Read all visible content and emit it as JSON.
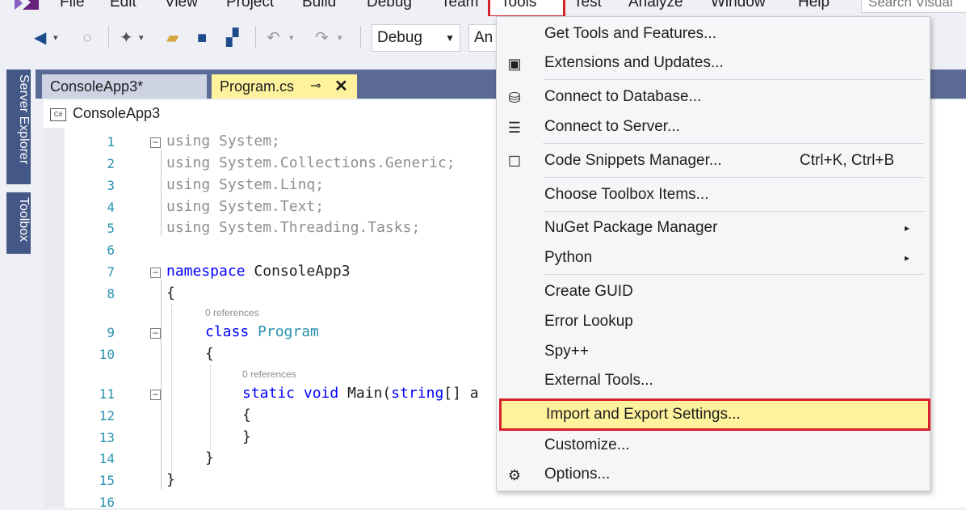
{
  "menubar": {
    "items": [
      "File",
      "Edit",
      "View",
      "Project",
      "Build",
      "Debug",
      "Team",
      "Tools",
      "Test",
      "Analyze",
      "Window",
      "Help"
    ],
    "search_placeholder": "Search Visual"
  },
  "toolbar": {
    "config_value": "Debug",
    "platform_value": "An"
  },
  "dock": {
    "server_explorer": "Server Explorer",
    "toolbox": "Toolbox"
  },
  "tabs": {
    "inactive": "ConsoleApp3*",
    "active": "Program.cs"
  },
  "navbar": {
    "project": "ConsoleApp3"
  },
  "editor": {
    "line_numbers": [
      "1",
      "2",
      "3",
      "4",
      "5",
      "6",
      "7",
      "8",
      "9",
      "10",
      "11",
      "12",
      "13",
      "14",
      "15",
      "16"
    ],
    "lines": {
      "l1": "System;",
      "l2": "System.Collections.Generic;",
      "l3": "System.Linq;",
      "l4": "System.Text;",
      "l5": "System.Threading.Tasks;",
      "ns_name": "ConsoleApp3",
      "class_name": "Program",
      "main_sig": "Main(",
      "main_args": "[] a",
      "using_kw": "using",
      "namespace_kw": "namespace",
      "class_kw": "class",
      "static_kw": "static",
      "void_kw": "void",
      "string_kw": "string",
      "brace_open": "{",
      "brace_close": "}"
    },
    "lens_class": "0 references",
    "lens_main": "0 references"
  },
  "tools_menu": {
    "items": [
      {
        "label": "Get Tools and Features..."
      },
      {
        "label": "Extensions and Updates...",
        "icon": "extensions-icon"
      },
      {
        "label": "Connect to Database...",
        "icon": "database-icon"
      },
      {
        "label": "Connect to Server...",
        "icon": "server-icon"
      },
      {
        "label": "Code Snippets Manager...",
        "shortcut": "Ctrl+K, Ctrl+B",
        "icon": "checkbox-icon"
      },
      {
        "label": "Choose Toolbox Items..."
      },
      {
        "label": "NuGet Package Manager",
        "submenu_arrow": "▸"
      },
      {
        "label": "Python",
        "submenu_arrow": "▸"
      },
      {
        "label": "Create GUID"
      },
      {
        "label": "Error Lookup"
      },
      {
        "label": "Spy++"
      },
      {
        "label": "External Tools..."
      },
      {
        "label": "Import and Export Settings..."
      },
      {
        "label": "Customize..."
      },
      {
        "label": "Options...",
        "icon": "gear-icon"
      }
    ]
  },
  "colors": {
    "accent_highlight": "#fff29d",
    "callout_red": "#d8202a",
    "tab_strip": "#5b6a94",
    "keyword_blue": "#0000ff",
    "type_teal": "#2b91af"
  }
}
